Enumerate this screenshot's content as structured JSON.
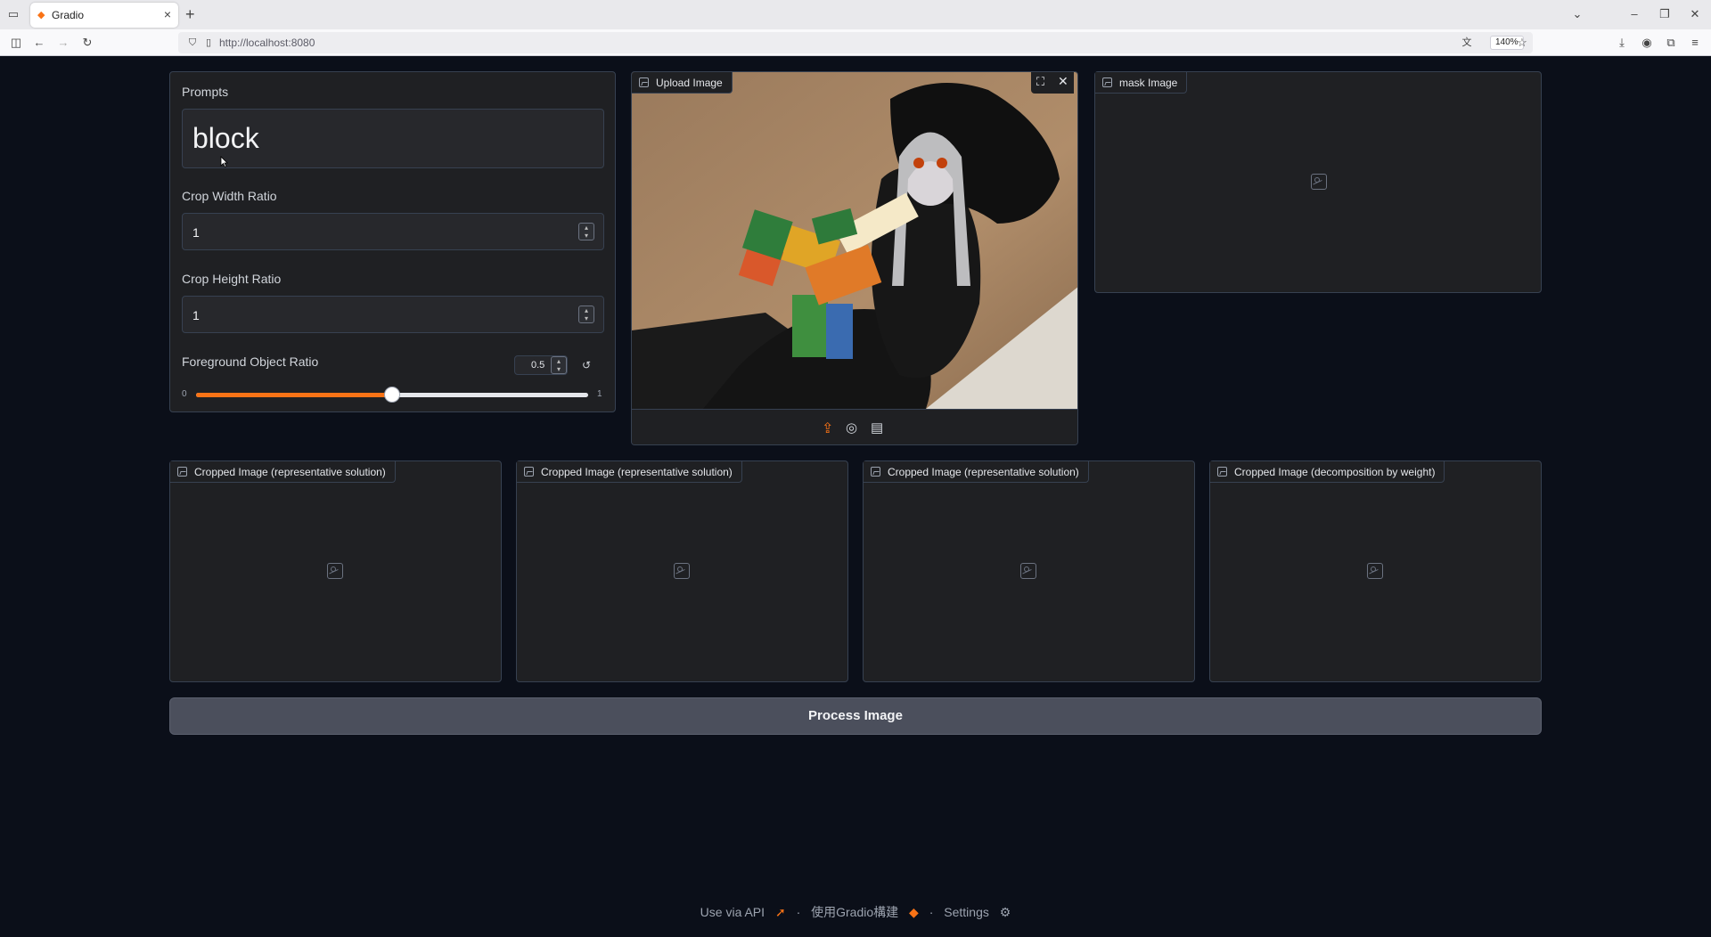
{
  "browser": {
    "tab_title": "Gradio",
    "url": "http://localhost:8080",
    "zoom": "140%"
  },
  "prompts": {
    "label": "Prompts",
    "value": "block"
  },
  "crop_width": {
    "label": "Crop Width Ratio",
    "value": "1"
  },
  "crop_height": {
    "label": "Crop Height Ratio",
    "value": "1"
  },
  "foreground": {
    "label": "Foreground Object Ratio",
    "value": "0.5",
    "min": "0",
    "max": "1",
    "fraction": 0.5
  },
  "upload": {
    "label": "Upload Image"
  },
  "mask": {
    "label": "mask Image"
  },
  "outputs": [
    {
      "label": "Cropped Image (representative solution)"
    },
    {
      "label": "Cropped Image (representative solution)"
    },
    {
      "label": "Cropped Image (representative solution)"
    },
    {
      "label": "Cropped Image (decomposition by weight)"
    }
  ],
  "process_button": "Process Image",
  "footer": {
    "api": "Use via API",
    "built": "使用Gradio構建",
    "settings": "Settings",
    "sep": "·"
  },
  "colors": {
    "accent": "#f97316",
    "background": "#0b0f19",
    "panel": "#1f2023"
  }
}
